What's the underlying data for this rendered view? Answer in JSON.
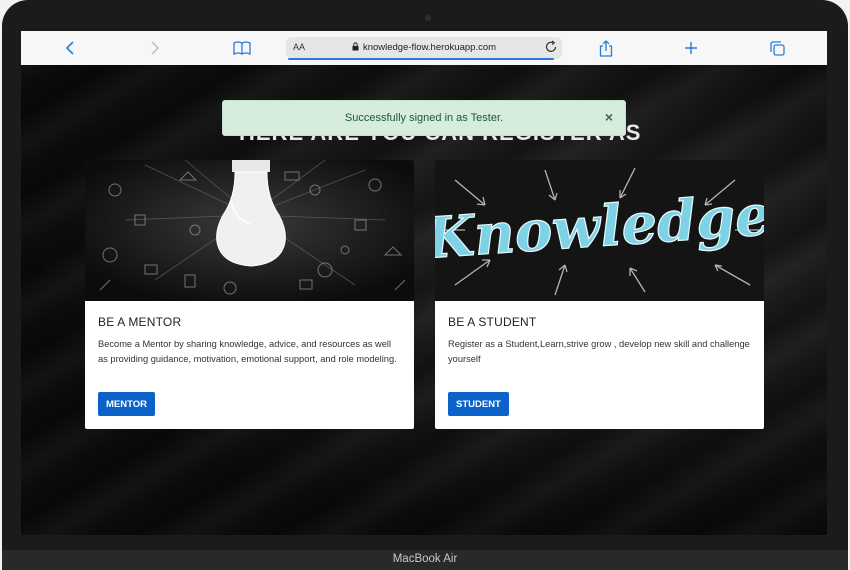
{
  "browser": {
    "address_aa": "AA",
    "url": "knowledge-flow.herokuapp.com",
    "accent": "#2a7ae2"
  },
  "page": {
    "heading": "HERE ARE YOU CAN REGISTER AS",
    "alert": {
      "message": "Successfully signed in as Tester.",
      "close": "×",
      "color": "#d6ecdc"
    },
    "cards": [
      {
        "title": "BE A MENTOR",
        "text": "Become a Mentor by sharing knowledge, advice, and resources as well as providing guidance, motivation, emotional support, and role modeling.",
        "button": "MENTOR",
        "image_icon": "lightbulb-image"
      },
      {
        "title": "BE A STUDENT",
        "text": "Register as a Student,Learn,strive grow , develop new skill and challenge yourself",
        "button": "STUDENT",
        "image_icon": "knowledge-chalkboard-image",
        "image_word": "Knowledge"
      }
    ],
    "button_color": "#0b63c9"
  },
  "device": {
    "label": "MacBook Air"
  }
}
